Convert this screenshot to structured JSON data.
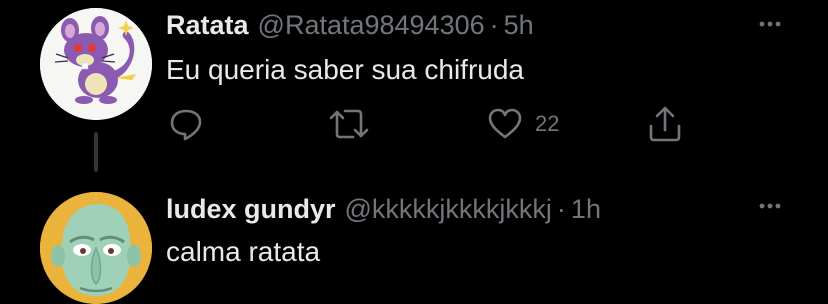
{
  "tweets": [
    {
      "display_name": "Ratata",
      "handle": "@Ratata98494306",
      "separator": "·",
      "time": "5h",
      "text": "Eu queria saber sua chifruda",
      "avatar": "rattata-avatar",
      "actions": {
        "like_count": "22"
      }
    },
    {
      "display_name": "ludex gundyr",
      "handle": "@kkkkkjkkkkjkkkj",
      "separator": "·",
      "time": "1h",
      "text": "calma ratata",
      "avatar": "squidward-avatar"
    }
  ],
  "icons": {
    "reply": "reply-icon",
    "retweet": "retweet-icon",
    "like": "heart-icon",
    "share": "share-icon",
    "more": "more-dots-icon"
  },
  "colors": {
    "background": "#000000",
    "text": "#e7e9ea",
    "secondary": "#71767b",
    "thread_line": "#333639"
  }
}
